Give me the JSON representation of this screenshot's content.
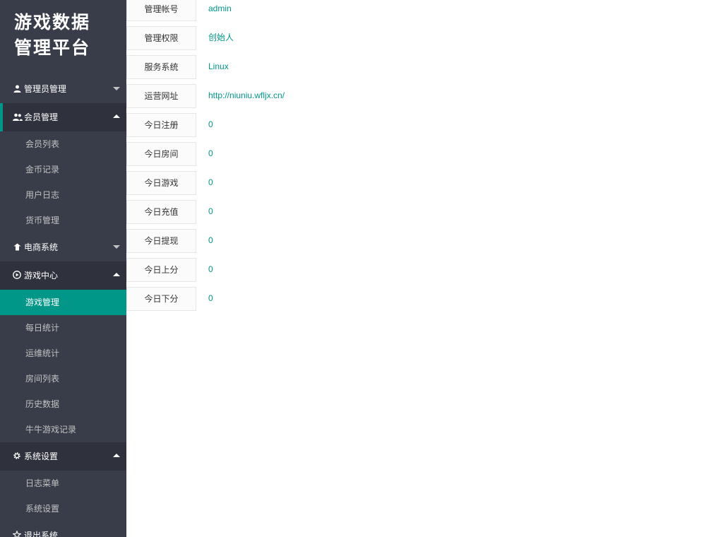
{
  "app": {
    "title_line1": "游戏数据",
    "title_line2": "管理平台"
  },
  "sidebar": {
    "groups": [
      {
        "label": "管理员管理",
        "icon": "user-icon",
        "expanded": false,
        "items": []
      },
      {
        "label": "会员管理",
        "icon": "users-icon",
        "expanded": true,
        "items": [
          {
            "label": "会员列表"
          },
          {
            "label": "金币记录"
          },
          {
            "label": "用户日志"
          },
          {
            "label": "货币管理"
          }
        ]
      },
      {
        "label": "电商系统",
        "icon": "shop-icon",
        "expanded": false,
        "items": []
      },
      {
        "label": "游戏中心",
        "icon": "play-circle-icon",
        "expanded": true,
        "items": [
          {
            "label": "游戏管理",
            "active": true
          },
          {
            "label": "每日统计"
          },
          {
            "label": "运维统计"
          },
          {
            "label": "房间列表"
          },
          {
            "label": "历史数据"
          },
          {
            "label": "牛牛游戏记录"
          }
        ]
      },
      {
        "label": "系统设置",
        "icon": "gear-icon",
        "expanded": true,
        "items": [
          {
            "label": "日志菜单"
          },
          {
            "label": "系统设置"
          }
        ]
      },
      {
        "label": "退出系统",
        "icon": "exit-icon",
        "expanded": false,
        "items": []
      }
    ]
  },
  "info": {
    "rows": [
      {
        "label": "管理帐号",
        "value": "admin"
      },
      {
        "label": "管理权限",
        "value": "创始人"
      },
      {
        "label": "服务系统",
        "value": "Linux"
      },
      {
        "label": "运营网址",
        "value": "http://niuniu.wfljx.cn/"
      },
      {
        "label": "今日注册",
        "value": "0"
      },
      {
        "label": "今日房间",
        "value": "0"
      },
      {
        "label": "今日游戏",
        "value": "0"
      },
      {
        "label": "今日充值",
        "value": "0"
      },
      {
        "label": "今日提现",
        "value": "0"
      },
      {
        "label": "今日上分",
        "value": "0"
      },
      {
        "label": "今日下分",
        "value": "0"
      }
    ]
  },
  "colors": {
    "sidebar_bg": "#393d49",
    "accent": "#009688"
  }
}
